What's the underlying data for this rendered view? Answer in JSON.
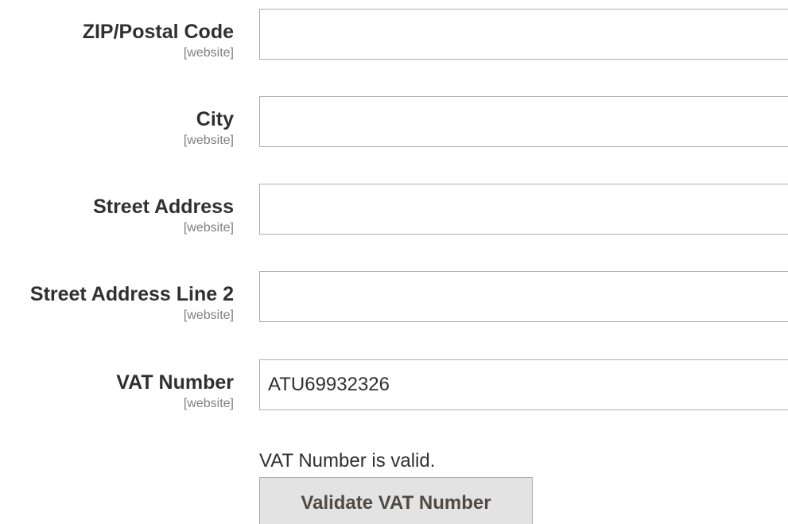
{
  "fields": [
    {
      "label": "ZIP/Postal Code",
      "scope": "[website]",
      "value": ""
    },
    {
      "label": "City",
      "scope": "[website]",
      "value": ""
    },
    {
      "label": "Street Address",
      "scope": "[website]",
      "value": ""
    },
    {
      "label": "Street Address Line 2",
      "scope": "[website]",
      "value": ""
    },
    {
      "label": "VAT Number",
      "scope": "[website]",
      "value": "ATU69932326"
    }
  ],
  "vat_status": "VAT Number is valid.",
  "validate_button_label": "Validate VAT Number"
}
